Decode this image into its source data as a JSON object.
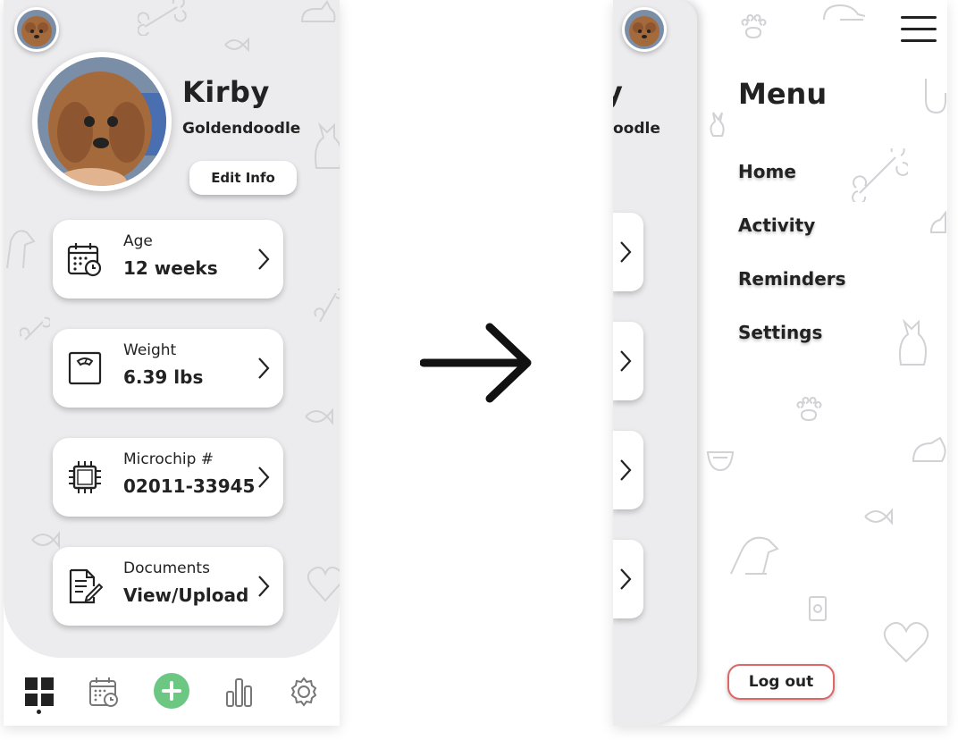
{
  "profile": {
    "name": "Kirby",
    "breed": "Goldendoodle",
    "edit_label": "Edit Info"
  },
  "cards": [
    {
      "label": "Age",
      "value": "12 weeks",
      "icon": "calendar-clock-icon"
    },
    {
      "label": "Weight",
      "value": "6.39 lbs",
      "icon": "scale-icon"
    },
    {
      "label": "Microchip #",
      "value": "02011-33945",
      "icon": "microchip-icon"
    },
    {
      "label": "Documents",
      "value": "View/Upload",
      "icon": "document-edit-icon"
    }
  ],
  "nav": {
    "items": [
      "dashboard-icon",
      "calendar-icon",
      "add-icon",
      "stats-icon",
      "settings-icon"
    ],
    "active": "dashboard-icon",
    "add_color": "#6cc783"
  },
  "peek": {
    "name_fragment": "y",
    "breed_fragment": "oodle"
  },
  "menu": {
    "title": "Menu",
    "items": [
      "Home",
      "Activity",
      "Reminders",
      "Settings"
    ],
    "logout_label": "Log out",
    "logout_color": "#d66"
  },
  "colors": {
    "background": "#ececee",
    "accent": "#6cc783"
  }
}
